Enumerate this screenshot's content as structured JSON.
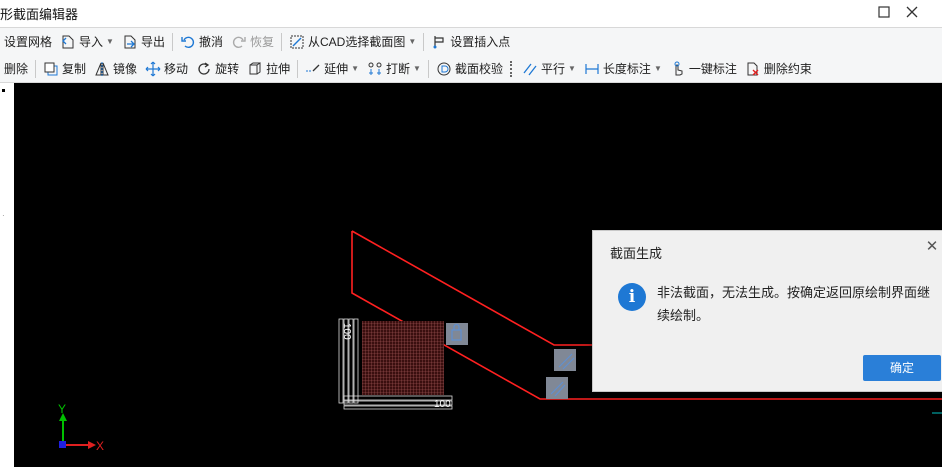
{
  "window": {
    "title": "形截面编辑器",
    "maximize_icon": "maximize-icon",
    "close_icon": "close-icon"
  },
  "toolbar1": {
    "grid": "设置网格",
    "import": "导入",
    "export": "导出",
    "undo": "撤消",
    "redo": "恢复",
    "select_from_cad": "从CAD选择截面图",
    "insert_point": "设置插入点"
  },
  "toolbar2": {
    "delete": "删除",
    "copy": "复制",
    "mirror": "镜像",
    "move": "移动",
    "rotate": "旋转",
    "stretch": "拉伸",
    "extend": "延伸",
    "break": "打断",
    "check": "截面校验",
    "parallel": "平行",
    "length_dim": "长度标注",
    "one_click_dim": "一键标注",
    "delete_constraint": "删除约束"
  },
  "canvas": {
    "background": "#000000",
    "outline_color": "#ff2020",
    "axis_y": "Y",
    "axis_x": "X",
    "dim_label": "100"
  },
  "dialog": {
    "title": "截面生成",
    "message": "非法截面，无法生成。按确定返回原绘制界面继续绘制。",
    "ok": "确定",
    "accent": "#2a7fd8"
  }
}
